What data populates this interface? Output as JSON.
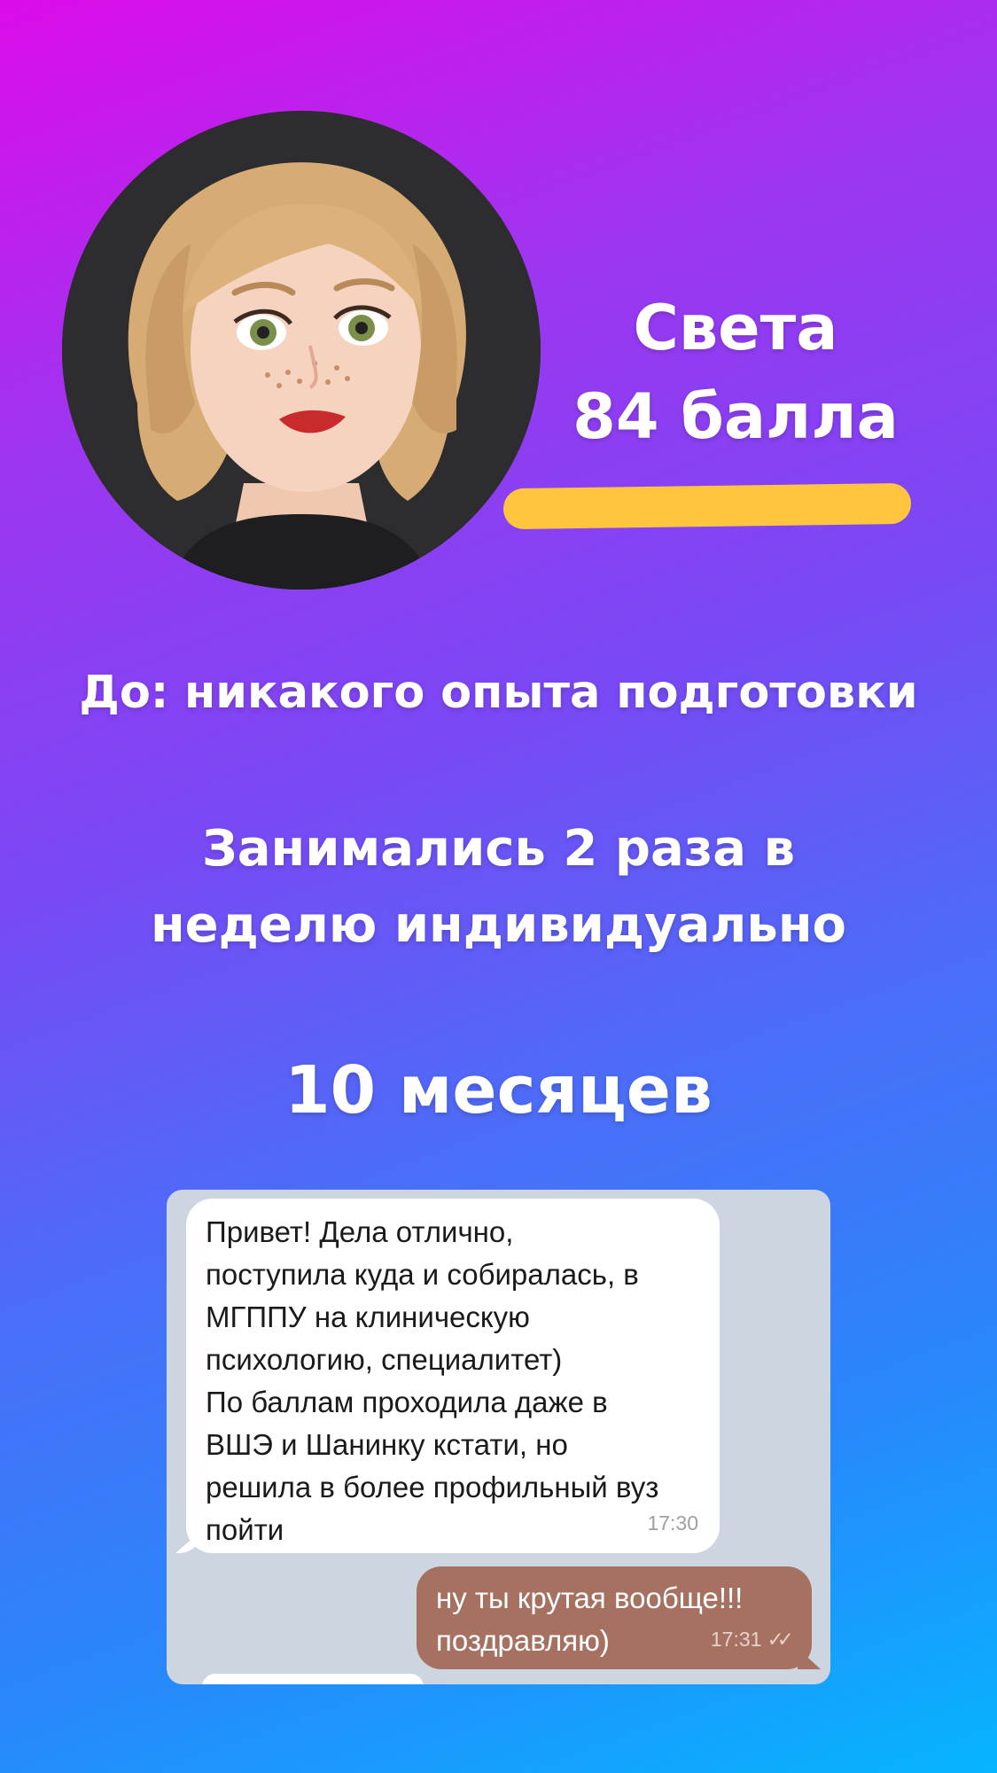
{
  "profile": {
    "avatar_icon": "memoji-avatar-icon",
    "name": "Света",
    "score": "84 балла",
    "highlight_color": "#ffc53e"
  },
  "before": "До:  никакого опыта подготовки",
  "frequency": {
    "line1": "Занимались 2 раза в",
    "line2": "неделю индивидуально"
  },
  "duration": "10 месяцев",
  "chat": {
    "incoming": {
      "text": "Привет! Дела отлично,\nпоступила куда и собиралась, в\nМГППУ на клиническую\nпсихологию, специалитет)\nПо баллам проходила даже в\nВШЭ и Шанинку кстати, но\nрешила в более профильный вуз\nпойти",
      "time": "17:30"
    },
    "outgoing": {
      "text": "ну ты крутая вообще!!!\nпоздравляю)",
      "time": "17:31",
      "status_icon": "double-check-icon"
    }
  }
}
